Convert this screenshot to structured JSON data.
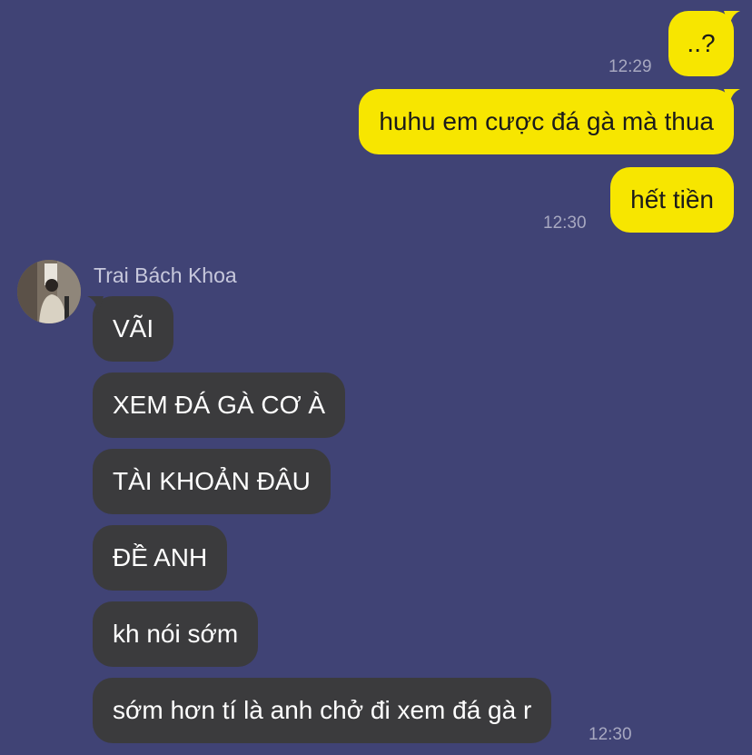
{
  "theme": {
    "background": "#404375",
    "sent_bubble": "#f7e600",
    "received_bubble": "#3b3b3d",
    "timestamp_color": "#a7a8c0"
  },
  "sent_messages": [
    {
      "text": "..?",
      "time": "12:29"
    },
    {
      "text": "huhu em cược đá gà mà thua",
      "time": ""
    },
    {
      "text": "hết tiền",
      "time": "12:30"
    }
  ],
  "sender": {
    "name": "Trai Bách Khoa",
    "avatar_icon": "profile-photo-icon"
  },
  "received_messages": [
    {
      "text": "VÃI"
    },
    {
      "text": "XEM ĐÁ GÀ CƠ À"
    },
    {
      "text": "TÀI KHOẢN ĐÂU"
    },
    {
      "text": "ĐỀ ANH"
    },
    {
      "text": "kh nói sớm"
    },
    {
      "text": "sớm hơn tí là anh chở đi xem đá gà r"
    }
  ],
  "received_time": "12:30"
}
